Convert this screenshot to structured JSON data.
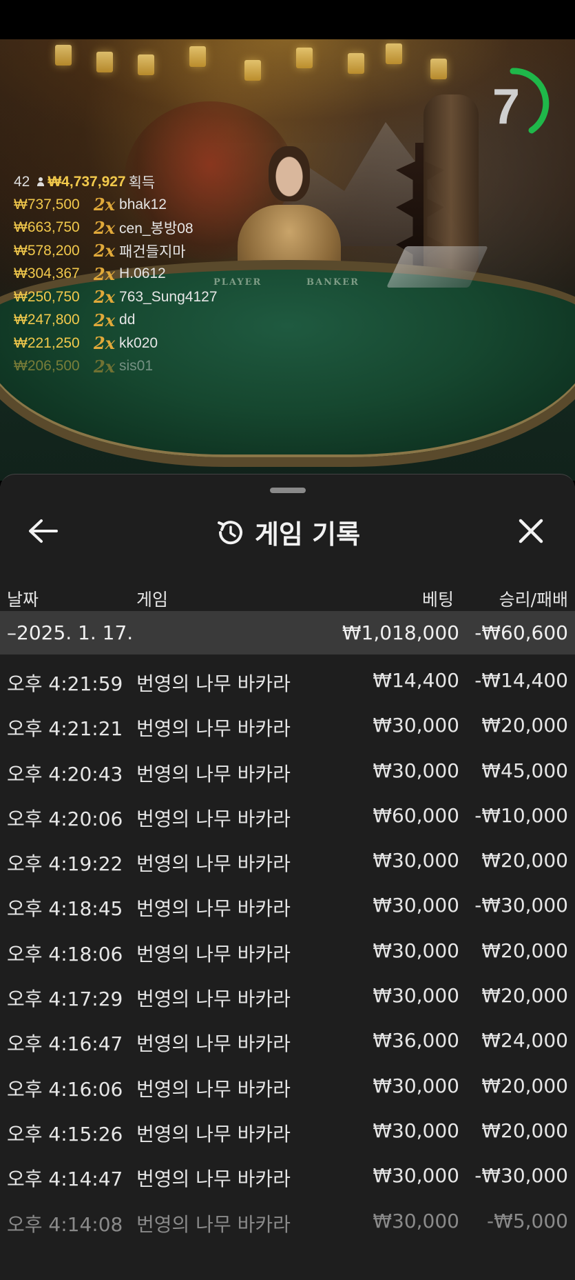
{
  "live": {
    "countdown": "7",
    "winners_count": "42",
    "winners_total": "₩4,737,927",
    "winners_suffix": "획득",
    "winners": [
      {
        "amount": "₩737,500",
        "mult": "2x",
        "name": "bhak12"
      },
      {
        "amount": "₩663,750",
        "mult": "2x",
        "name": "cen_봉방08"
      },
      {
        "amount": "₩578,200",
        "mult": "2x",
        "name": "패건들지마"
      },
      {
        "amount": "₩304,367",
        "mult": "2x",
        "name": "H.0612"
      },
      {
        "amount": "₩250,750",
        "mult": "2x",
        "name": "763_Sung4127"
      },
      {
        "amount": "₩247,800",
        "mult": "2x",
        "name": "dd"
      },
      {
        "amount": "₩221,250",
        "mult": "2x",
        "name": "kk020"
      },
      {
        "amount": "₩206,500",
        "mult": "2x",
        "name": "sis01"
      }
    ],
    "table_player": "PLAYER",
    "table_banker": "BANKER",
    "colors": {
      "timer_arc": "#1fb84a",
      "gold": "#f2c94c"
    }
  },
  "sheet": {
    "title": "게임 기록",
    "icons": {
      "back": "arrow-left-icon",
      "history": "history-icon",
      "close": "close-icon"
    },
    "columns": {
      "date": "날짜",
      "game": "게임",
      "bet": "베팅",
      "result": "승리/패배"
    },
    "day": {
      "label": "–2025. 1. 17.",
      "bet": "₩1,018,000",
      "result": "-₩60,600"
    },
    "rows": [
      {
        "time": "오후 4:21:59",
        "game": "번영의 나무 바카라",
        "bet": "₩14,400",
        "result": "-₩14,400"
      },
      {
        "time": "오후 4:21:21",
        "game": "번영의 나무 바카라",
        "bet": "₩30,000",
        "result": "₩20,000"
      },
      {
        "time": "오후 4:20:43",
        "game": "번영의 나무 바카라",
        "bet": "₩30,000",
        "result": "₩45,000"
      },
      {
        "time": "오후 4:20:06",
        "game": "번영의 나무 바카라",
        "bet": "₩60,000",
        "result": "-₩10,000"
      },
      {
        "time": "오후 4:19:22",
        "game": "번영의 나무 바카라",
        "bet": "₩30,000",
        "result": "₩20,000"
      },
      {
        "time": "오후 4:18:45",
        "game": "번영의 나무 바카라",
        "bet": "₩30,000",
        "result": "-₩30,000"
      },
      {
        "time": "오후 4:18:06",
        "game": "번영의 나무 바카라",
        "bet": "₩30,000",
        "result": "₩20,000"
      },
      {
        "time": "오후 4:17:29",
        "game": "번영의 나무 바카라",
        "bet": "₩30,000",
        "result": "₩20,000"
      },
      {
        "time": "오후 4:16:47",
        "game": "번영의 나무 바카라",
        "bet": "₩36,000",
        "result": "₩24,000"
      },
      {
        "time": "오후 4:16:06",
        "game": "번영의 나무 바카라",
        "bet": "₩30,000",
        "result": "₩20,000"
      },
      {
        "time": "오후 4:15:26",
        "game": "번영의 나무 바카라",
        "bet": "₩30,000",
        "result": "₩20,000"
      },
      {
        "time": "오후 4:14:47",
        "game": "번영의 나무 바카라",
        "bet": "₩30,000",
        "result": "-₩30,000"
      },
      {
        "time": "오후 4:14:08",
        "game": "번영의 나무 바카라",
        "bet": "₩30,000",
        "result": "-₩5,000"
      }
    ]
  }
}
